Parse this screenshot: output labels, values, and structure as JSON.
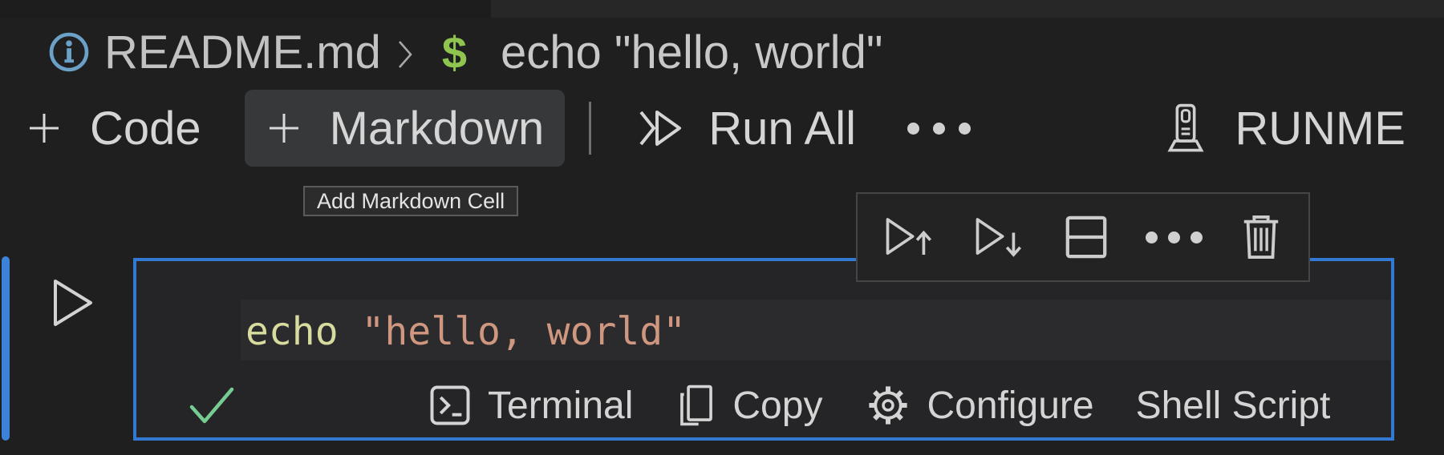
{
  "theme": {
    "bg": "#1f1f20",
    "tab-strip-active": "#1d1d1e",
    "tab-strip-rest": "#272728",
    "text-primary": "#d6d6d6",
    "text-breadcrumb": "#c2c2c2",
    "accent-blue": "#3279d2",
    "info-blue": "#6ba1c7",
    "prompt-green": "#8fc54f",
    "success-green": "#77cc92",
    "hover-bg": "#37383a",
    "tooltip-bg": "#2c2c2d",
    "tooltip-border": "#5a5a5a",
    "cell-bg": "#252527",
    "cell-toolbar-border": "#454546",
    "line-highlight": "#2b2b2d",
    "code-command": "#d7dc9e",
    "code-string": "#cf977f"
  },
  "breadcrumb": {
    "file": "README.md",
    "prompt_symbol": "$",
    "command": "echo \"hello, world\""
  },
  "toolbar": {
    "add_code_label": "Code",
    "add_markdown_label": "Markdown",
    "run_all_label": "Run All",
    "runme_label": "RUNME"
  },
  "tooltip": {
    "text": "Add Markdown Cell"
  },
  "cell_toolbar": {
    "buttons": [
      "execute-above",
      "execute-cell-and-below",
      "split-cell",
      "more-actions",
      "delete-cell"
    ]
  },
  "cell": {
    "code_tokens": {
      "command": "echo",
      "string": " \"hello, world\""
    },
    "status_bar": {
      "terminal_label": "Terminal",
      "copy_label": "Copy",
      "configure_label": "Configure",
      "language_label": "Shell Script"
    }
  }
}
